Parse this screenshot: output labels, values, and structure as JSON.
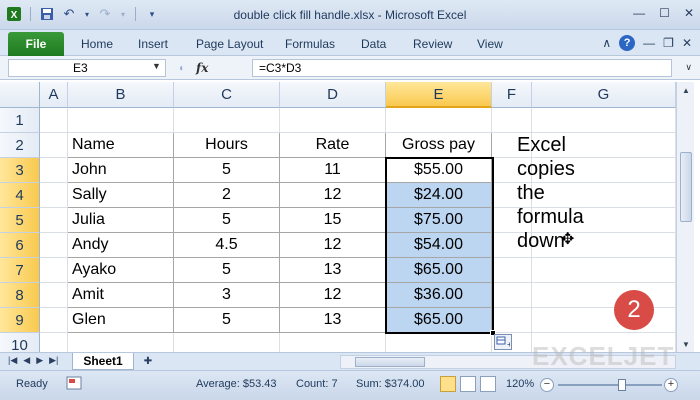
{
  "window": {
    "title": "double click fill handle.xlsx  -  Microsoft Excel"
  },
  "ribbon": {
    "file_label": "File",
    "tabs": [
      "Home",
      "Insert",
      "Page Layout",
      "Formulas",
      "Data",
      "Review",
      "View"
    ]
  },
  "formula_bar": {
    "name_box": "E3",
    "fx_label": "fx",
    "formula": "=C3*D3"
  },
  "columns": [
    "A",
    "B",
    "C",
    "D",
    "E",
    "F",
    "G"
  ],
  "selected_column": "E",
  "rows": [
    "1",
    "2",
    "3",
    "4",
    "5",
    "6",
    "7",
    "8",
    "9",
    "10"
  ],
  "selected_rows": [
    "3",
    "4",
    "5",
    "6",
    "7",
    "8",
    "9"
  ],
  "table": {
    "headers": [
      "Name",
      "Hours",
      "Rate",
      "Gross pay"
    ],
    "rows": [
      [
        "John",
        "5",
        "11",
        "$55.00"
      ],
      [
        "Sally",
        "2",
        "12",
        "$24.00"
      ],
      [
        "Julia",
        "5",
        "15",
        "$75.00"
      ],
      [
        "Andy",
        "4.5",
        "12",
        "$54.00"
      ],
      [
        "Ayako",
        "5",
        "13",
        "$65.00"
      ],
      [
        "Amit",
        "3",
        "12",
        "$36.00"
      ],
      [
        "Glen",
        "5",
        "13",
        "$65.00"
      ]
    ]
  },
  "note": {
    "line1": "Excel copies",
    "line2": "the formula",
    "line3": "down"
  },
  "badge": "2",
  "sheet_tabs": [
    "Sheet1"
  ],
  "watermark": "EXCELJET",
  "status_bar": {
    "mode": "Ready",
    "average": "Average: $53.43",
    "count": "Count: 7",
    "sum": "Sum: $374.00",
    "zoom": "120%",
    "zoom_level": 0.62
  },
  "colors": {
    "selection_fill": "#bcd6f2",
    "header_selected": "#f9c94f",
    "file_tab": "#1f7a1f",
    "badge": "#d84b47"
  }
}
